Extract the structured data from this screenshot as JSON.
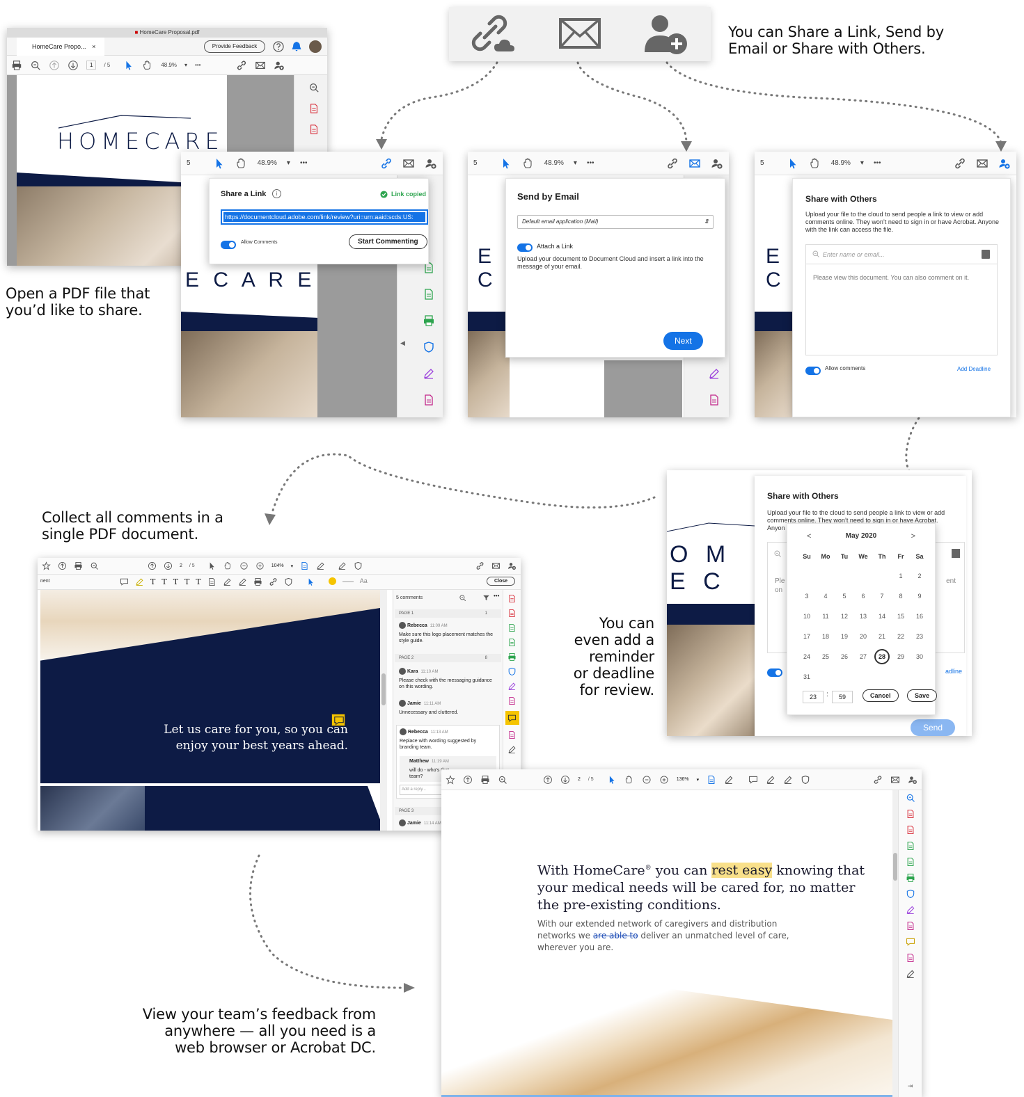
{
  "colors": {
    "accent": "#1473e6",
    "navy": "#0d1b45",
    "success": "#2da44e",
    "arrow": "#666666",
    "highlight": "#f9e08a"
  },
  "top_icons": {
    "items": [
      "share-link-icon",
      "email-icon",
      "share-with-others-icon"
    ]
  },
  "captions": {
    "share_options": [
      "You can Share a Link, Send by",
      "Email or Share with Others."
    ],
    "open_pdf": [
      "Open a PDF file that",
      "you’d like to share."
    ],
    "collect": [
      "Collect all comments in a",
      "single PDF document."
    ],
    "reminder": [
      "You can",
      "even add a",
      "reminder",
      "or deadline",
      "for review."
    ],
    "view_feedback": [
      "View your team’s feedback from",
      "anywhere — all you need is a",
      "web browser or Acrobat DC."
    ]
  },
  "acrobat_window": {
    "window_title": "HomeCare Proposal.pdf",
    "tab_label": "HomeCare Propo...",
    "tab_close": "×",
    "feedback_button": "Provide Feedback",
    "page_current": "1",
    "page_total": "/ 5",
    "zoom": "48.9%",
    "more": "•••",
    "logo_text": "HOMECARE"
  },
  "share_link": {
    "page_num": "5",
    "zoom": "48.9%",
    "more": "•••",
    "title": "Share a Link",
    "info": "i",
    "status": "Link copied",
    "url": "https://documentcloud.adobe.com/link/review?uri=urn:aaid:scds:US:",
    "allow_comments": "Allow Comments",
    "start_button": "Start Commenting",
    "bg_letters": "E  C A R E"
  },
  "send_email": {
    "page_num": "5",
    "zoom": "48.9%",
    "more": "•••",
    "title": "Send by Email",
    "select_value": "Default email application (Mail)",
    "attach_label": "Attach a Link",
    "description": "Upload your document to Document Cloud and insert a link into the message of your email.",
    "next_button": "Next",
    "bg_letters": "E C"
  },
  "share_others": {
    "page_num": "5",
    "zoom": "48.9%",
    "more": "•••",
    "title": "Share with Others",
    "description": "Upload your file to the cloud to send people a link to view or add comments online. They won’t need to sign in or have Acrobat. Anyone with the link can access the file.",
    "recipient_placeholder": "Enter name or email...",
    "message": "Please view this document. You can also comment on it.",
    "allow_comments": "Allow comments",
    "deadline_link": "Add Deadline",
    "bg_letters": "E C"
  },
  "deadline_dialog": {
    "title": "Share with Others",
    "description": "Upload your file to the cloud to send people a link to view or add comments online. They won’t need to sign in or have Acrobat.",
    "description_cut": "Anyon",
    "partial_left": "Ple",
    "partial_left2": "on",
    "partial_right": "ent",
    "partial_deadline": "adline",
    "send_button": "Send",
    "bg_letters": "O M E C",
    "calendar": {
      "month": "May 2020",
      "prev": "<",
      "next": ">",
      "weekdays": [
        "Su",
        "Mo",
        "Tu",
        "We",
        "Th",
        "Fr",
        "Sa"
      ],
      "weeks": [
        [
          "",
          "",
          "",
          "",
          "",
          "1",
          "2"
        ],
        [
          "3",
          "4",
          "5",
          "6",
          "7",
          "8",
          "9"
        ],
        [
          "10",
          "11",
          "12",
          "13",
          "14",
          "15",
          "16"
        ],
        [
          "17",
          "18",
          "19",
          "20",
          "21",
          "22",
          "23"
        ],
        [
          "24",
          "25",
          "26",
          "27",
          "28",
          "29",
          "30"
        ],
        [
          "31",
          "",
          "",
          "",
          "",
          "",
          ""
        ]
      ],
      "selected_day": "28",
      "hour": "23",
      "colon": ":",
      "minute": "59",
      "cancel": "Cancel",
      "save": "Save"
    }
  },
  "comments_view": {
    "page_num": "2",
    "page_total": "/ 5",
    "zoom": "104%",
    "left_label": "nent",
    "close_button": "Close",
    "font_label": "Aa",
    "comment_count": "5 comments",
    "headline": [
      "Let us care for you, so you can",
      "enjoy your best years ahead."
    ],
    "comments": [
      {
        "page": "PAGE 1",
        "page_count": "1"
      },
      {
        "author": "Rebecca",
        "time": "11:09 AM",
        "text": "Make sure this logo placement matches the style guide."
      },
      {
        "page": "PAGE 2",
        "page_count": "8"
      },
      {
        "author": "Kara",
        "time": "11:10 AM",
        "text": "Please check with the messaging guidance on this wording."
      },
      {
        "author": "Jamie",
        "time": "11:11 AM",
        "text": "Unnecessary and cluttered."
      },
      {
        "author": "Rebecca",
        "time": "11:13 AM",
        "text": "Replace with wording suggested by branding team."
      },
      {
        "author": "Matthew",
        "time": "11:19 AM",
        "text": "will do - who's that team?"
      },
      {
        "reply_placeholder": "Add a reply..."
      },
      {
        "page": "PAGE 3"
      },
      {
        "author": "Jamie",
        "time": "11:14 AM",
        "text": ""
      }
    ]
  },
  "browser_view": {
    "page_num": "2",
    "page_total": "/ 5",
    "zoom": "136%",
    "heading_parts": [
      "With HomeCare",
      "®",
      " you can ",
      "rest easy",
      " knowing that"
    ],
    "heading_line2": "your medical needs will be cared for, no matter",
    "heading_line3": "the pre-existing conditions.",
    "body_line1": "With our extended network of caregivers and distribution",
    "body_line2_a": "networks we ",
    "body_line2_strike": "are able to",
    "body_line2_b": " deliver an unmatched level of care,",
    "body_line3": "wherever you are."
  }
}
